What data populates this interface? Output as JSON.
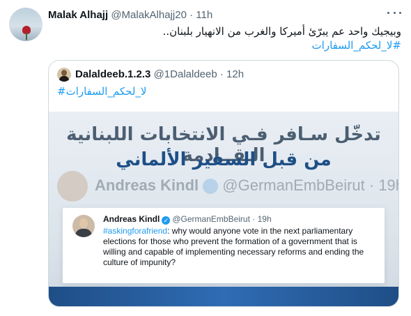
{
  "tweet": {
    "author_name": "Malak Alhajj",
    "author_handle": "@MalakAlhajj20",
    "separator": "·",
    "time": "11h",
    "text": "وبيجيك واحد عم يبرّئ أميركا والغرب من الانهيار بلبنان..",
    "hashtag": "#لا_لحكم_السفارات"
  },
  "quoted": {
    "author_name": "Dalaldeeb.1.2.3",
    "author_handle": "@1Dalaldeeb",
    "separator": "·",
    "time": "12h",
    "hashtag": "#لا_لحكم_السفارات",
    "media": {
      "banner_line1": "تدخّل سـافر فـي الانتخابات اللبنانية الـقــادمة",
      "banner_line2": "من قبل السفير الألماني",
      "ghost_name": "Andreas Kindl",
      "ghost_handle": "@GermanEmbBeirut · 19h",
      "inner": {
        "name": "Andreas Kindl",
        "check": "✓",
        "handle": "@GermanEmbBeirut",
        "separator": "·",
        "time": "19h",
        "hashtag": "#askingforafriend",
        "text": ": why would anyone vote in the next parliamentary elections for those who prevent the formation of a government that is willing and capable of implementing necessary reforms and ending the culture of impunity?"
      }
    }
  },
  "icons": {
    "more": "more-horizontal-icon",
    "verified": "verified-badge-icon"
  },
  "colors": {
    "link": "#1d9bf0",
    "muted": "#536471",
    "banner_blue": "#1e4f86"
  }
}
